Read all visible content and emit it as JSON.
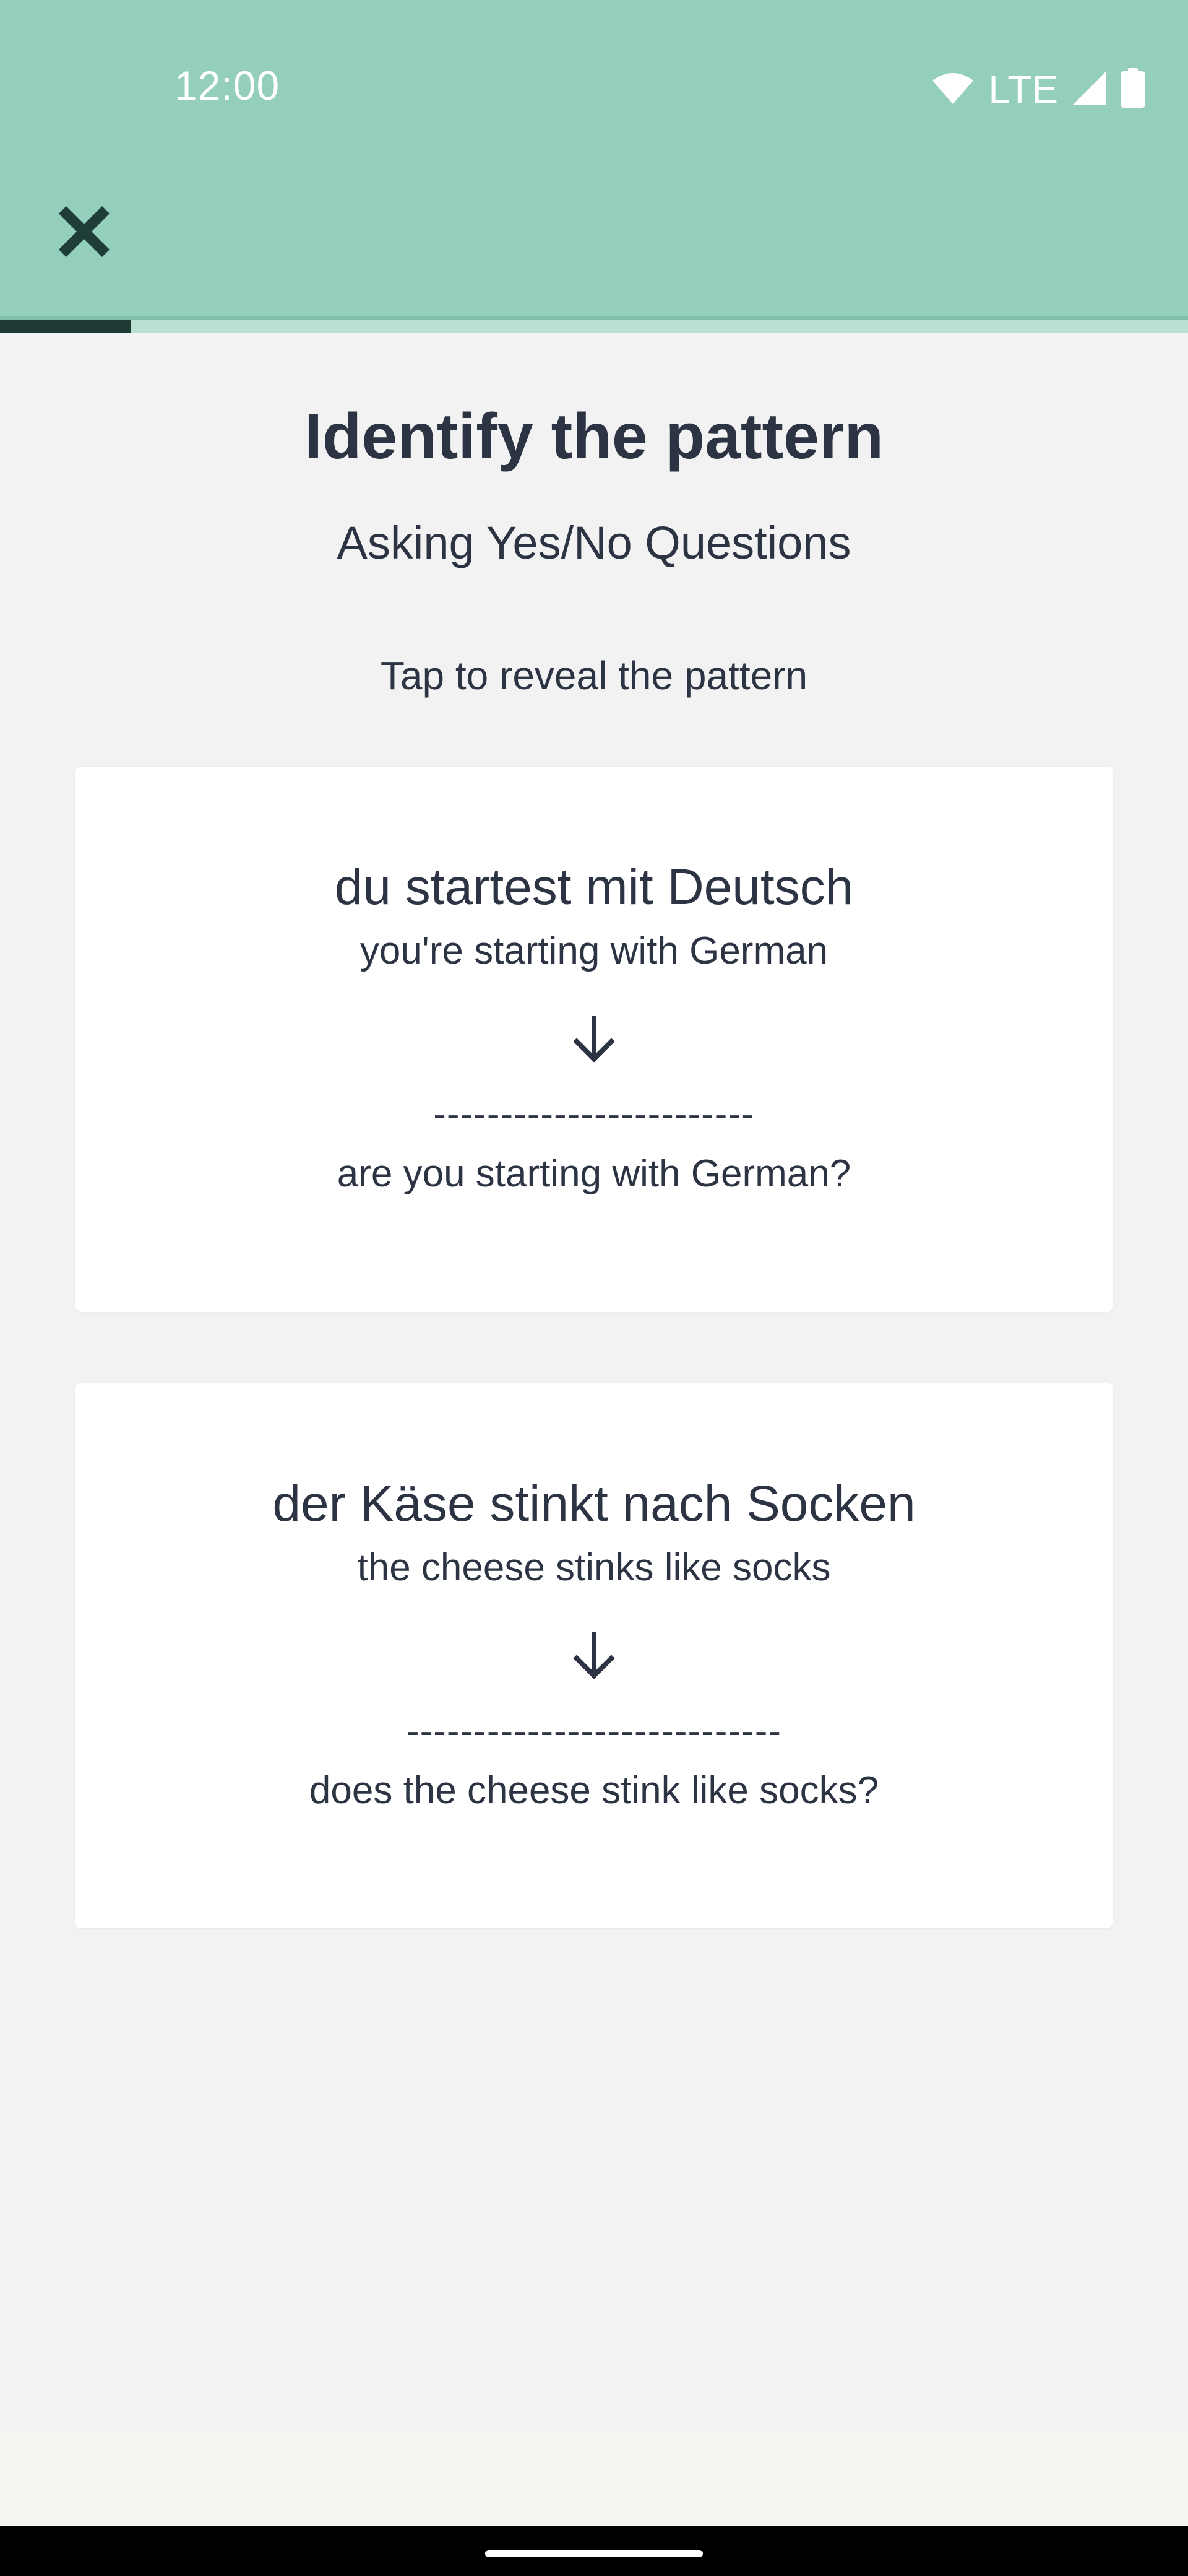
{
  "status_bar": {
    "time": "12:00",
    "network": "LTE",
    "icons": [
      "wifi-icon",
      "cell-signal-icon",
      "battery-icon"
    ]
  },
  "header": {
    "close_icon": "close-icon",
    "progress": 0.11
  },
  "lesson": {
    "title": "Identify the pattern",
    "subtitle": "Asking Yes/No Questions",
    "hint": "Tap to reveal the pattern"
  },
  "cards": [
    {
      "german": "du startest mit Deutsch",
      "english": "you're starting with German",
      "blank": "------------------------",
      "question": "are you starting with German?"
    },
    {
      "german": "der Käse stinkt nach Socken",
      "english": "the cheese stinks like socks",
      "blank": "----------------------------",
      "question": "does the cheese stink like socks?"
    }
  ],
  "colors": {
    "header_bg": "#93cfbc",
    "progress_fill": "#1d3a34",
    "page_bg": "#f2f2f2",
    "text": "#2c3444"
  }
}
